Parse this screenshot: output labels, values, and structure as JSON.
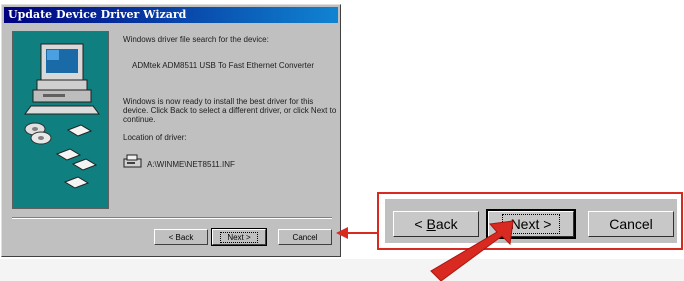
{
  "wizard": {
    "title": "Update Device Driver Wizard",
    "line1": "Windows driver file search for the device:",
    "device_name": "ADMtek ADM8511 USB To Fast Ethernet Converter",
    "ready_text": "Windows is now ready to install the best driver for this device. Click Back to select a different driver, or click Next to continue.",
    "location_label": "Location of driver:",
    "driver_path": "A:\\WINME\\NET8511.INF",
    "buttons": {
      "back": "< Back",
      "next": "Next >",
      "cancel": "Cancel"
    }
  },
  "zoom": {
    "buttons": {
      "back_prefix": "< ",
      "back_accel": "B",
      "back_rest": "ack",
      "next": "Next >",
      "cancel": "Cancel"
    }
  },
  "colors": {
    "annotation": "#d82a20",
    "art_background": "#0f7f7f",
    "title_bar": "#000080"
  },
  "icons": [
    "computer-icon",
    "disk-icon",
    "floppy-icon",
    "drive-icon",
    "arrow-icon"
  ]
}
